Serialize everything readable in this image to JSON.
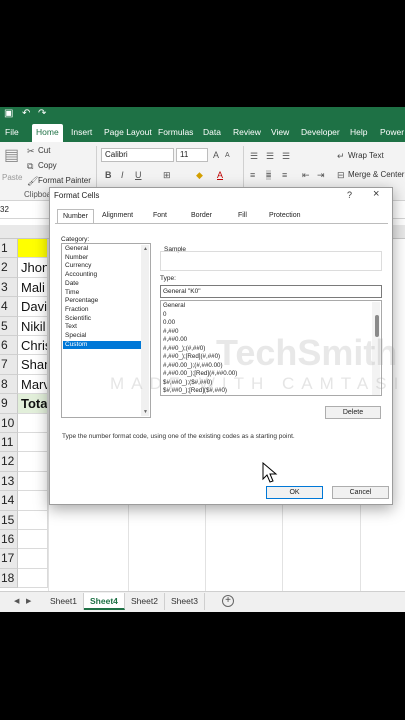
{
  "titlebar": {
    "save_icon": "save-icon",
    "undo_icon": "undo-icon"
  },
  "menu": {
    "tabs": [
      "File",
      "Home",
      "Insert",
      "Page Layout",
      "Formulas",
      "Data",
      "Review",
      "View",
      "Developer",
      "Help",
      "Power P"
    ],
    "active": "Home"
  },
  "ribbon": {
    "paste": "Paste",
    "cut": "Cut",
    "copy": "Copy",
    "format_painter": "Format Painter",
    "clipboard_group": "Clipboard",
    "font_name": "Calibri",
    "font_size": "11",
    "wrap_text": "Wrap Text",
    "merge_center": "Merge & Center"
  },
  "namebox": "32",
  "rows": [
    {
      "num": "1",
      "value": ""
    },
    {
      "num": "2",
      "value": "Jhon"
    },
    {
      "num": "3",
      "value": "Mali"
    },
    {
      "num": "4",
      "value": "Davi"
    },
    {
      "num": "5",
      "value": "Nikil"
    },
    {
      "num": "6",
      "value": "Chris"
    },
    {
      "num": "7",
      "value": "Shan"
    },
    {
      "num": "8",
      "value": "Marv"
    },
    {
      "num": "9",
      "value": "Tota"
    },
    {
      "num": "10",
      "value": ""
    },
    {
      "num": "11",
      "value": ""
    },
    {
      "num": "12",
      "value": ""
    },
    {
      "num": "13",
      "value": ""
    },
    {
      "num": "14",
      "value": ""
    },
    {
      "num": "15",
      "value": ""
    },
    {
      "num": "16",
      "value": ""
    },
    {
      "num": "17",
      "value": ""
    },
    {
      "num": "18",
      "value": ""
    }
  ],
  "sheets": {
    "tabs": [
      "Sheet1",
      "Sheet4",
      "Sheet2",
      "Sheet3"
    ],
    "active": "Sheet4",
    "add": "+"
  },
  "dialog": {
    "title": "Format Cells",
    "help": "?",
    "close": "×",
    "tabs": [
      "Number",
      "Alignment",
      "Font",
      "Border",
      "Fill",
      "Protection"
    ],
    "active_tab": "Number",
    "category_label": "Category:",
    "categories": [
      "General",
      "Number",
      "Currency",
      "Accounting",
      "Date",
      "Time",
      "Percentage",
      "Fraction",
      "Scientific",
      "Text",
      "Special",
      "Custom"
    ],
    "selected_category": "Custom",
    "sample_label": "Sample",
    "type_label": "Type:",
    "type_value": "General \"K0\"",
    "codes": [
      "General",
      "0",
      "0.00",
      "#,##0",
      "#,##0.00",
      "#,##0_);(#,##0)",
      "#,##0_);[Red](#,##0)",
      "#,##0.00_);(#,##0.00)",
      "#,##0.00_);[Red](#,##0.00)",
      "$#,##0_);($#,##0)",
      "$#,##0_);[Red]($#,##0)",
      "$#,##0.00_);($#,##0.00)"
    ],
    "delete": "Delete",
    "help_text": "Type the number format code, using one of the existing codes as a starting point.",
    "ok": "OK",
    "cancel": "Cancel"
  },
  "watermark": {
    "brand": "TechSmith",
    "tagline": "MADE WITH CAMTASIA F"
  },
  "colors": {
    "excel_green": "#1e7145",
    "selection_blue": "#0078d7",
    "header_yellow": "#ffff00",
    "total_green": "#e2efda"
  }
}
